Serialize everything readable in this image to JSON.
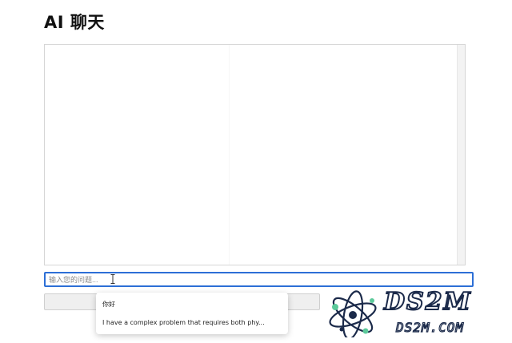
{
  "page": {
    "title": "AI 聊天"
  },
  "input": {
    "placeholder": "输入您的问题..."
  },
  "suggestions": [
    {
      "label": "你好"
    },
    {
      "label": "I have a complex problem that requires both phy..."
    }
  ],
  "watermark": {
    "main": "DS2M",
    "sub": "DS2M.COM"
  },
  "colors": {
    "input_focus_border": "#2d6fd6",
    "chat_border": "#d6d6d6",
    "button_bg": "#efefef",
    "logo_accent": "#1b2a4a"
  }
}
